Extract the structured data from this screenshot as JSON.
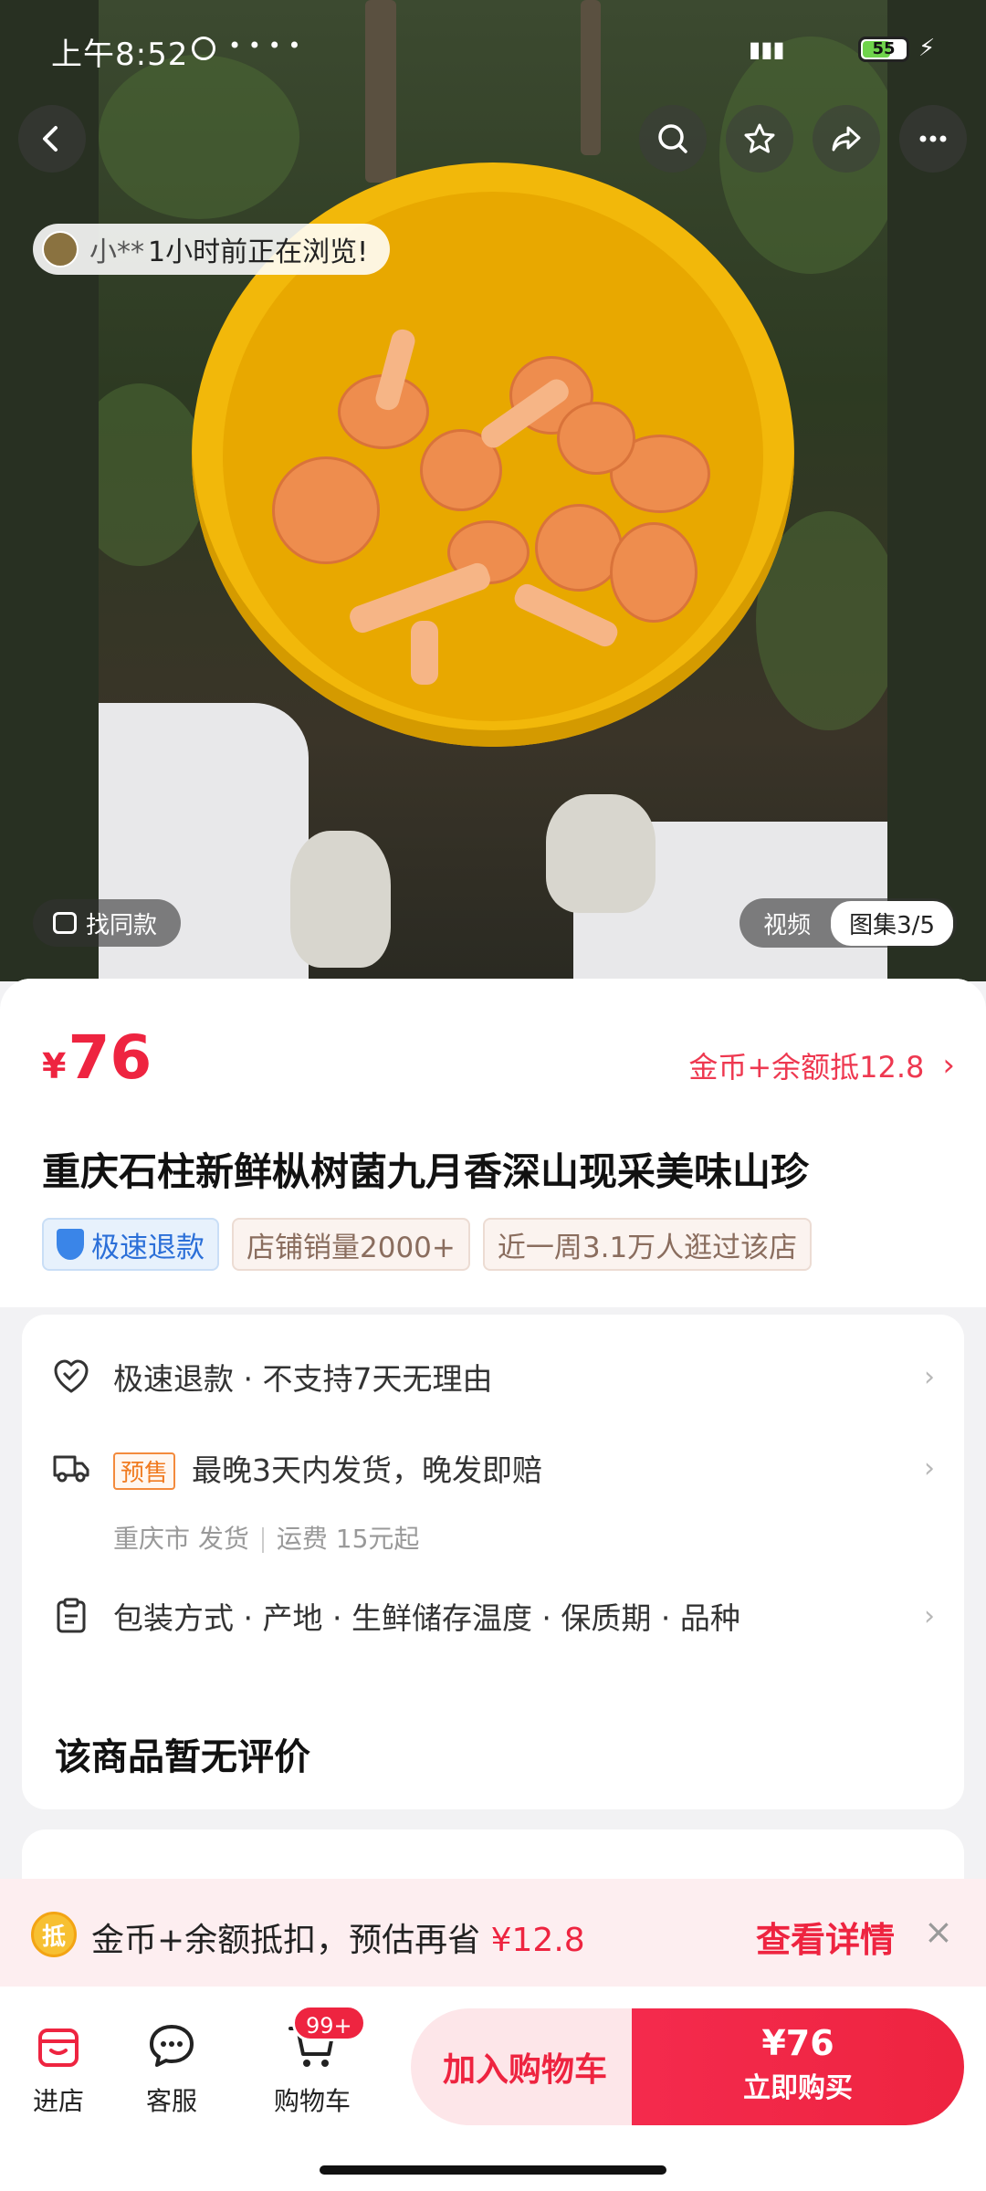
{
  "status_bar": {
    "time": "上午8:52",
    "battery": "55"
  },
  "top_actions": {
    "back_icon": "chevron-left-icon",
    "search_icon": "search-icon",
    "favorite_icon": "star-icon",
    "share_icon": "share-icon",
    "more_icon": "more-icon"
  },
  "browse_notice": {
    "name": "小**",
    "text": "1小时前正在浏览!"
  },
  "image_overlay": {
    "find_same": "找同款",
    "tab_video": "视频",
    "tab_album": "图集3/5"
  },
  "product": {
    "currency": "¥",
    "price": "76",
    "deduct_text": "金币+余额抵12.8",
    "title": "重庆石柱新鲜枞树菌九月香深山现采美味山珍",
    "tags": [
      "极速退款",
      "店铺销量2000+",
      "近一周3.1万人逛过该店"
    ]
  },
  "service_rows": {
    "refund": "极速退款 · 不支持7天无理由",
    "presale_tag": "预售",
    "shipping": "最晚3天内发货，晚发即赔",
    "ship_from": "重庆市 发货",
    "freight": "运费 15元起",
    "params": "包装方式 · 产地 · 生鲜储存温度 · 保质期 · 品种"
  },
  "reviews": {
    "title": "该商品暂无评价"
  },
  "coupon_bar": {
    "coin": "抵",
    "text": "金币+余额抵扣，预估再省 ",
    "amount": "¥12.8",
    "detail": "查看详情",
    "close": "×"
  },
  "bottom_bar": {
    "store": "进店",
    "service": "客服",
    "cart": "购物车",
    "cart_badge": "99+",
    "add_cart": "加入购物车",
    "buy_price": "¥76",
    "buy_now": "立即购买"
  },
  "colors": {
    "accent": "#ee2440",
    "presale": "#f07b20",
    "tag_blue": "#2b6fd8"
  }
}
